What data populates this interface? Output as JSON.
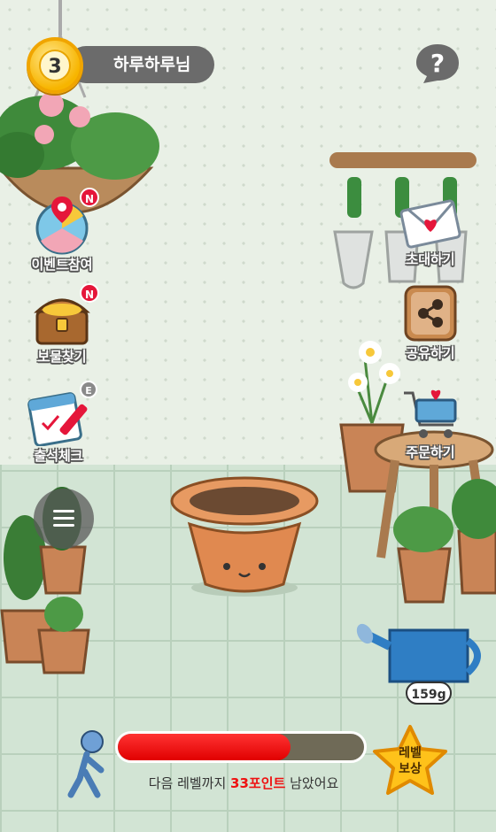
{
  "header": {
    "level": "3",
    "nickname": "하루하루님",
    "help_icon": "question-mark-icon"
  },
  "left_menu": [
    {
      "label": "이벤트참여",
      "badge": "N",
      "icon": "event-wheel-icon"
    },
    {
      "label": "보물찾기",
      "badge": "N",
      "icon": "treasure-chest-icon"
    },
    {
      "label": "출석체크",
      "badge": "E",
      "icon": "calendar-pencil-icon"
    }
  ],
  "right_menu": [
    {
      "label": "초대하기",
      "icon": "envelope-heart-icon"
    },
    {
      "label": "공유하기",
      "icon": "share-icon"
    },
    {
      "label": "주문하기",
      "icon": "shopping-cart-icon"
    }
  ],
  "watering_can": {
    "amount": "159g"
  },
  "progress": {
    "fraction": 0.7,
    "prefix": "다음 레벨까지 ",
    "points": "33포인트",
    "suffix": " 남았어요"
  },
  "reward": {
    "line1": "레벨",
    "line2": "보상"
  },
  "colors": {
    "progress_fill": "#e10000",
    "accent_gold": "#f7b500",
    "badge_red": "#e5163a"
  }
}
